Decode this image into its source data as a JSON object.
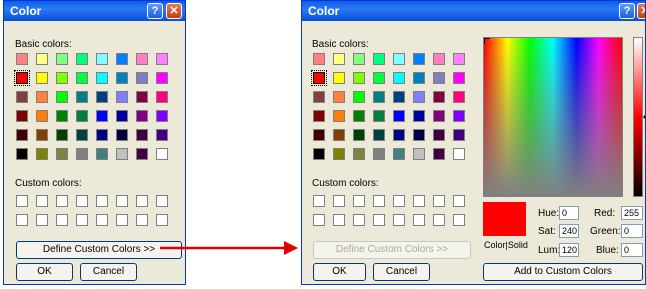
{
  "left_dialog": {
    "title": "Color",
    "basic_colors_label": "Basic colors:",
    "custom_colors_label": "Custom colors:",
    "define_button": "Define Custom Colors >>",
    "ok_button": "OK",
    "cancel_button": "Cancel"
  },
  "right_dialog": {
    "title": "Color",
    "basic_colors_label": "Basic colors:",
    "custom_colors_label": "Custom colors:",
    "define_button": "Define Custom Colors >>",
    "ok_button": "OK",
    "cancel_button": "Cancel",
    "color_solid_label": "Color|Solid",
    "hue_label": "Hue:",
    "hue_value": "0",
    "sat_label": "Sat:",
    "sat_value": "240",
    "lum_label": "Lum:",
    "lum_value": "120",
    "red_label": "Red:",
    "red_value": "255",
    "green_label": "Green:",
    "green_value": "0",
    "blue_label": "Blue:",
    "blue_value": "0",
    "add_button": "Add to Custom Colors",
    "preview_color": "#ff0000"
  },
  "basic_colors": [
    [
      "#ff8080",
      "#ffff80",
      "#80ff80",
      "#00ff80",
      "#80ffff",
      "#0080ff",
      "#ff80c0",
      "#ff80ff"
    ],
    [
      "#ff0000",
      "#ffff00",
      "#80ff00",
      "#00ff40",
      "#00ffff",
      "#0080c0",
      "#8080c0",
      "#ff00ff"
    ],
    [
      "#804040",
      "#ff8040",
      "#00ff00",
      "#008080",
      "#004080",
      "#8080ff",
      "#800040",
      "#ff0080"
    ],
    [
      "#800000",
      "#ff8000",
      "#008000",
      "#008040",
      "#0000ff",
      "#0000a0",
      "#800080",
      "#8000ff"
    ],
    [
      "#400000",
      "#804000",
      "#004000",
      "#004040",
      "#000080",
      "#000040",
      "#400040",
      "#400080"
    ],
    [
      "#000000",
      "#808000",
      "#808040",
      "#808080",
      "#408080",
      "#c0c0c0",
      "#400040",
      "#ffffff"
    ]
  ],
  "selected_color": "#ff0000",
  "title_help_icon": "?",
  "title_close_icon": "✕"
}
